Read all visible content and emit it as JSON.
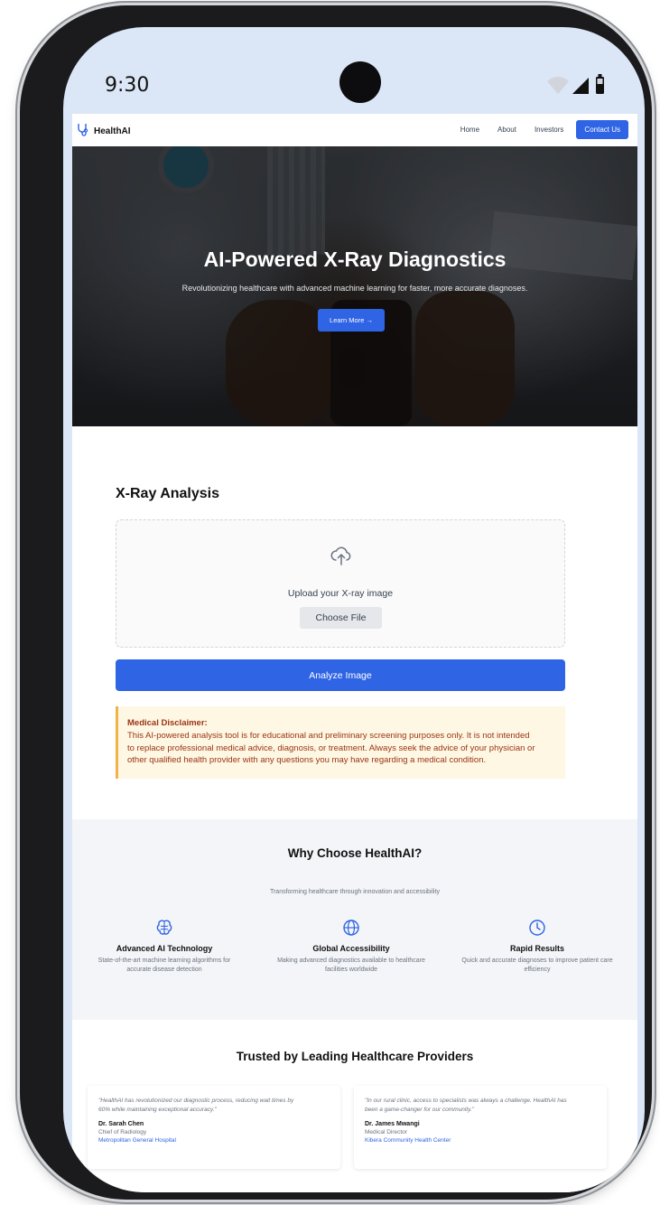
{
  "status": {
    "time": "9:30"
  },
  "nav": {
    "brand": "HealthAI",
    "links": [
      "Home",
      "About",
      "Investors"
    ],
    "cta": "Contact Us"
  },
  "hero": {
    "title": "AI-Powered X-Ray Diagnostics",
    "subtitle": "Revolutionizing healthcare with advanced machine learning for faster, more accurate diagnoses.",
    "button": "Learn More →"
  },
  "analysis": {
    "title": "X-Ray Analysis",
    "upload_text": "Upload your X-ray image",
    "choose_file": "Choose File",
    "analyze_button": "Analyze Image"
  },
  "disclaimer": {
    "title": "Medical Disclaimer:",
    "lines": [
      "This AI-powered analysis tool is for educational and preliminary screening purposes only. It is not intended",
      "to replace professional medical advice, diagnosis, or treatment. Always seek the advice of your physician or",
      "other qualified health provider with any questions you may have regarding a medical condition."
    ]
  },
  "why": {
    "title": "Why Choose HealthAI?",
    "subtitle": "Transforming healthcare through innovation and accessibility",
    "features": [
      {
        "icon": "brain-icon",
        "title": "Advanced AI Technology",
        "desc_lines": [
          "State-of-the-art machine learning algorithms for",
          "accurate disease detection"
        ]
      },
      {
        "icon": "globe-icon",
        "title": "Global Accessibility",
        "desc_lines": [
          "Making advanced diagnostics available to healthcare",
          "facilities worldwide"
        ]
      },
      {
        "icon": "clock-icon",
        "title": "Rapid Results",
        "desc_lines": [
          "Quick and accurate diagnoses to improve patient care",
          "efficiency"
        ]
      }
    ]
  },
  "trust": {
    "title": "Trusted by Leading Healthcare Providers",
    "testimonials": [
      {
        "quote_lines": [
          "\"HealthAI has revolutionized our diagnostic process, reducing wait times by",
          "60% while maintaining exceptional accuracy.\""
        ],
        "name": "Dr. Sarah Chen",
        "role": "Chief of Radiology",
        "org": "Metropolitan General Hospital"
      },
      {
        "quote_lines": [
          "\"In our rural clinic, access to specialists was always a challenge. HealthAI has",
          "been a game-changer for our community.\""
        ],
        "name": "Dr. James Mwangi",
        "role": "Medical Director",
        "org": "Kibera Community Health Center"
      }
    ]
  },
  "colors": {
    "primary": "#2f64e4",
    "disclaimer_bg": "#fef7e4",
    "disclaimer_border": "#f2b24a",
    "disclaimer_text": "#9a3412"
  }
}
